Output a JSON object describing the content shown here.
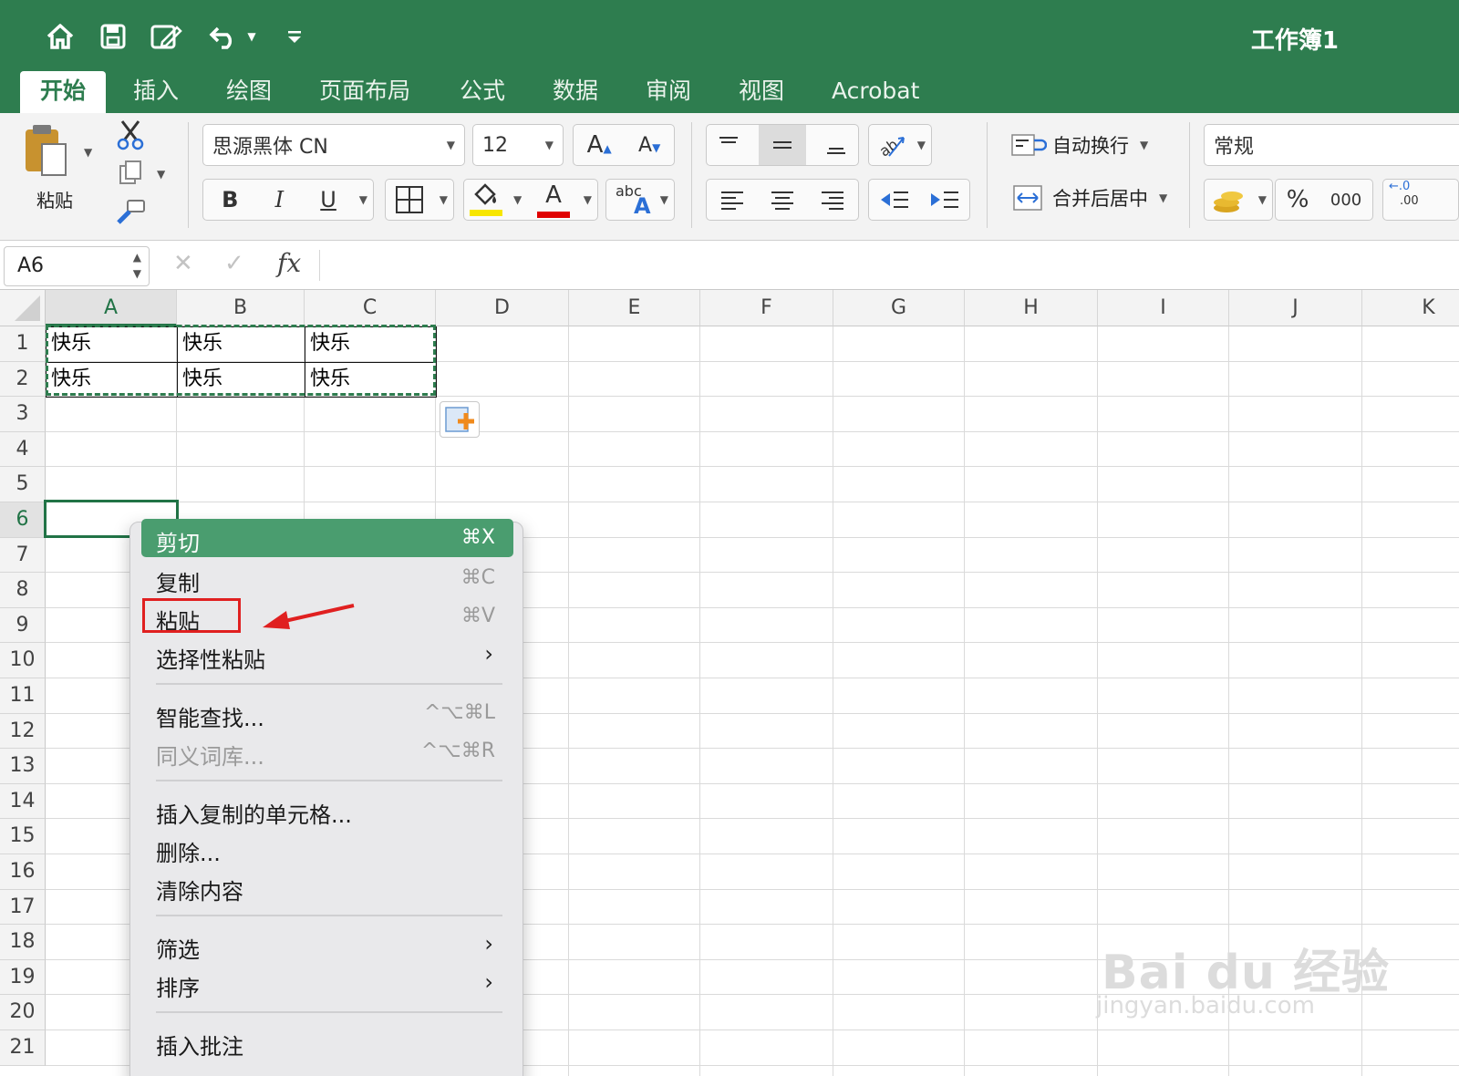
{
  "window": {
    "title": "工作簿1"
  },
  "ribbon_tabs": [
    "开始",
    "插入",
    "绘图",
    "页面布局",
    "公式",
    "数据",
    "审阅",
    "视图",
    "Acrobat"
  ],
  "active_tab": "开始",
  "ribbon": {
    "paste_label": "粘贴",
    "font_name": "思源黑体 CN",
    "font_size": "12",
    "grow_font": "A",
    "shrink_font": "A",
    "bold": "B",
    "italic": "I",
    "underline": "U",
    "highlight_letter": "A",
    "wrap_text": "自动换行",
    "merge_center": "合并后居中",
    "number_format": "常规",
    "percent": "%",
    "thousands": "000",
    "increase_decimal_top": "←.0",
    "increase_decimal_bottom": ".00",
    "abc": "abc",
    "abc_a": "A",
    "highlight_color": "#f7e600",
    "font_color": "#e00000"
  },
  "formula_bar": {
    "name_box": "A6",
    "fx": "fx",
    "cancel": "✕",
    "confirm": "✓",
    "formula": ""
  },
  "columns": [
    "A",
    "B",
    "C",
    "D",
    "E",
    "F",
    "G",
    "H",
    "I",
    "J",
    "K"
  ],
  "rows": [
    "1",
    "2",
    "3",
    "4",
    "5",
    "6",
    "7",
    "8",
    "9",
    "10",
    "11",
    "12",
    "13",
    "14",
    "15",
    "16",
    "17",
    "18",
    "19",
    "20",
    "21"
  ],
  "cells": {
    "A1": "快乐",
    "B1": "快乐",
    "C1": "快乐",
    "A2": "快乐",
    "B2": "快乐",
    "C2": "快乐"
  },
  "selected_cell": "A6",
  "context_menu": {
    "items": [
      {
        "label": "剪切",
        "shortcut": "⌘X"
      },
      {
        "label": "复制",
        "shortcut": "⌘C"
      },
      {
        "label": "粘贴",
        "shortcut": "⌘V"
      },
      {
        "label": "选择性粘贴",
        "submenu": "›"
      },
      {
        "label": "智能查找...",
        "shortcut": "^⌥⌘L"
      },
      {
        "label": "同义词库...",
        "shortcut": "^⌥⌘R"
      },
      {
        "label": "插入复制的单元格..."
      },
      {
        "label": "删除..."
      },
      {
        "label": "清除内容"
      },
      {
        "label": "筛选",
        "submenu": "›"
      },
      {
        "label": "排序",
        "submenu": "›"
      },
      {
        "label": "插入批注"
      }
    ],
    "highlighted": "剪切",
    "annotated": "粘贴"
  },
  "colors": {
    "brand": "#2e7d4f",
    "menu_highlight": "#4a9d6f",
    "annotation": "#e02020"
  },
  "watermark": {
    "logo": "Bai du 经验",
    "url": "jingyan.baidu.com"
  }
}
